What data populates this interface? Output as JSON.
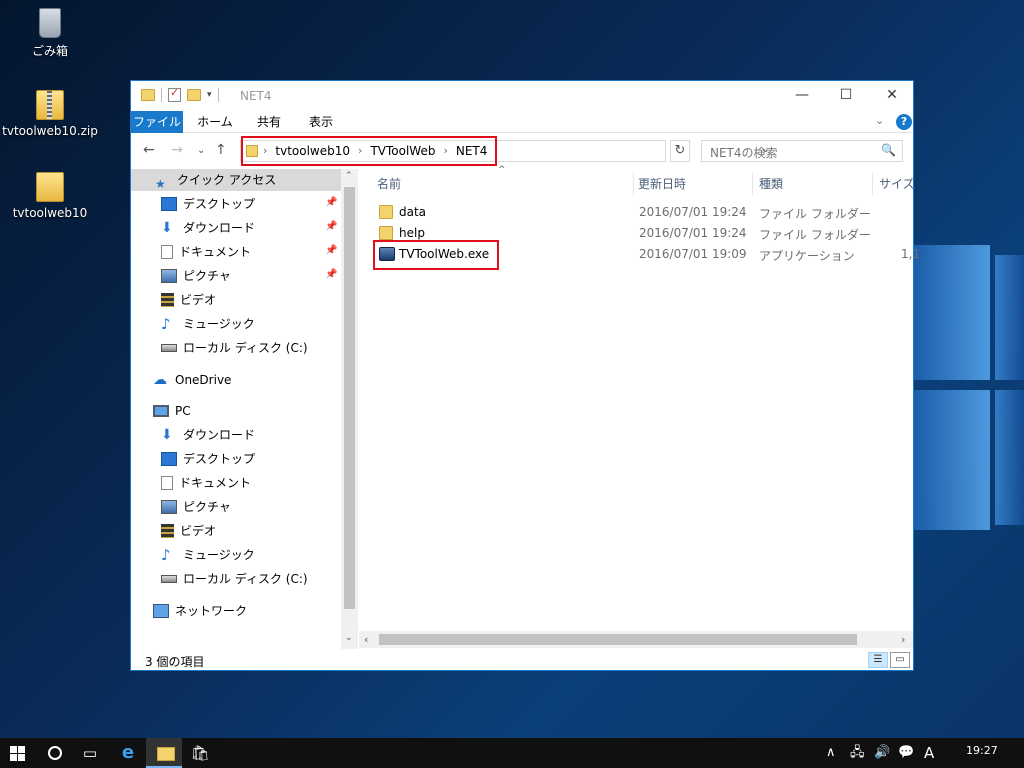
{
  "desktop": {
    "icons": [
      {
        "label": "ごみ箱",
        "icon": "recycle-bin-icon"
      },
      {
        "label": "tvtoolweb10.zip",
        "icon": "zip-folder-icon"
      },
      {
        "label": "tvtoolweb10",
        "icon": "folder-icon"
      }
    ]
  },
  "window": {
    "title": "NET4",
    "ribbon_tabs": [
      "ファイル",
      "ホーム",
      "共有",
      "表示"
    ],
    "breadcrumb": [
      "tvtoolweb10",
      "TVToolWeb",
      "NET4"
    ],
    "search_placeholder": "NET4の検索",
    "nav": [
      {
        "label": "クイック アクセス",
        "icon": "star-icon",
        "selected": true
      },
      {
        "label": "デスクトップ",
        "icon": "desktop-icon",
        "pinned": true
      },
      {
        "label": "ダウンロード",
        "icon": "download-icon",
        "pinned": true
      },
      {
        "label": "ドキュメント",
        "icon": "document-icon",
        "pinned": true
      },
      {
        "label": "ピクチャ",
        "icon": "pictures-icon",
        "pinned": true
      },
      {
        "label": "ビデオ",
        "icon": "video-icon"
      },
      {
        "label": "ミュージック",
        "icon": "music-icon"
      },
      {
        "label": "ローカル ディスク (C:)",
        "icon": "disk-icon"
      },
      {
        "label": "OneDrive",
        "icon": "onedrive-icon"
      },
      {
        "label": "PC",
        "icon": "pc-icon"
      },
      {
        "label": "ダウンロード",
        "icon": "download-icon"
      },
      {
        "label": "デスクトップ",
        "icon": "desktop-icon"
      },
      {
        "label": "ドキュメント",
        "icon": "document-icon"
      },
      {
        "label": "ピクチャ",
        "icon": "pictures-icon"
      },
      {
        "label": "ビデオ",
        "icon": "video-icon"
      },
      {
        "label": "ミュージック",
        "icon": "music-icon"
      },
      {
        "label": "ローカル ディスク (C:)",
        "icon": "disk-icon"
      },
      {
        "label": "ネットワーク",
        "icon": "network-icon"
      }
    ],
    "columns": [
      "名前",
      "更新日時",
      "種類",
      "サイズ"
    ],
    "files": [
      {
        "name": "data",
        "modified": "2016/07/01 19:24",
        "type": "ファイル フォルダー",
        "size": "",
        "icon": "folder-icon"
      },
      {
        "name": "help",
        "modified": "2016/07/01 19:24",
        "type": "ファイル フォルダー",
        "size": "",
        "icon": "folder-icon"
      },
      {
        "name": "TVToolWeb.exe",
        "modified": "2016/07/01 19:09",
        "type": "アプリケーション",
        "size": "1,1",
        "icon": "application-icon"
      }
    ],
    "status": "3 個の項目"
  },
  "taskbar": {
    "ime": "A",
    "time": "19:27"
  },
  "colors": {
    "accent": "#1979ca",
    "highlight": "#e0101a"
  }
}
